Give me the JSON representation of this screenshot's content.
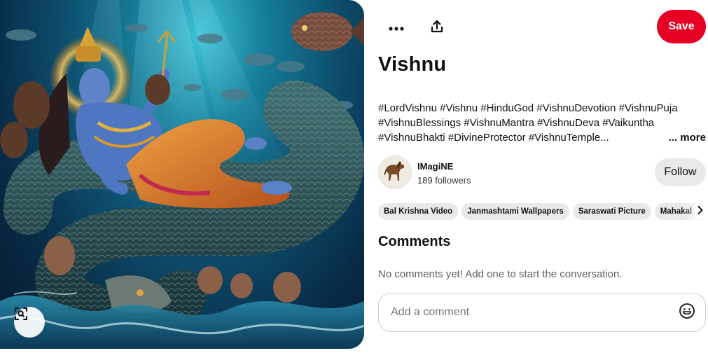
{
  "pin": {
    "title": "Vishnu",
    "description_lines": [
      "#LordVishnu #Vishnu #HinduGod #VishnuDevotion #VishnuPuja",
      "#VishnuBlessings #VishnuMantra #VishnuDeva #Vaikuntha",
      "#VishnuBhakti #DivineProtector #VishnuTemple..."
    ],
    "more_label": "... more"
  },
  "toolbar": {
    "more_icon": "more-horizontal-icon",
    "share_icon": "share-upload-icon",
    "save_label": "Save"
  },
  "creator": {
    "name": "IMagiNE",
    "followers": "189 followers",
    "follow_label": "Follow",
    "avatar_icon": "horse-avatar-icon"
  },
  "chips": [
    "Bal Krishna Video",
    "Janmashtami Wallpapers",
    "Saraswati Picture",
    "Mahakal Ph"
  ],
  "comments": {
    "heading": "Comments",
    "empty_text": "No comments yet! Add one to start the conversation.",
    "placeholder": "Add a comment"
  },
  "image": {
    "lens_icon": "visual-search-icon"
  },
  "colors": {
    "save": "#e60023",
    "chip_bg": "#e9e9e9",
    "muted_text": "#5f5f5f"
  }
}
